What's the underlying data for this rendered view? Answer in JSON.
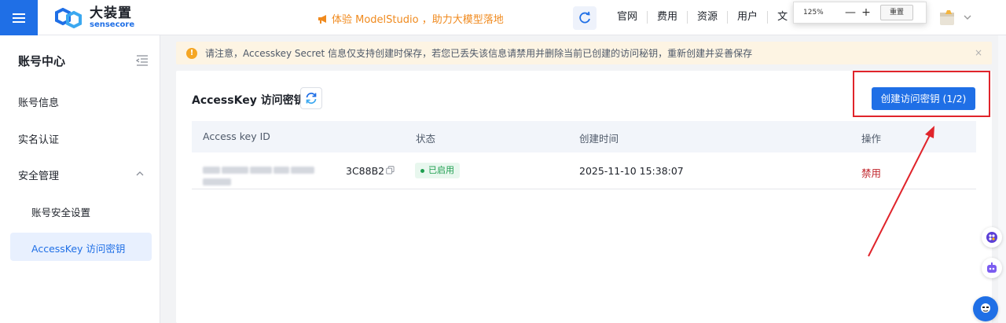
{
  "header": {
    "logo_cn": "大装置",
    "logo_en": "sensecore",
    "promo": "体验 ModelStudio ，助力大模型落地",
    "nav": [
      "官网",
      "费用",
      "资源",
      "用户",
      "文"
    ],
    "zoom": {
      "value": "125%",
      "minus": "—",
      "plus": "+",
      "reset": "重置"
    }
  },
  "sidebar": {
    "title": "账号中心",
    "items": [
      {
        "label": "账号信息"
      },
      {
        "label": "实名认证"
      },
      {
        "label": "安全管理"
      }
    ],
    "sub_items": [
      {
        "label": "账号安全设置"
      },
      {
        "label": "AccessKey 访问密钥"
      }
    ]
  },
  "notice": {
    "text": "请注意，Accesskey Secret 信息仅支持创建时保存，若您已丢失该信息请禁用并删除当前已创建的访问秘钥，重新创建并妥善保存",
    "close": "×"
  },
  "card": {
    "title": "AccessKey 访问密钥",
    "create_button": "创建访问密钥 (1/2)",
    "columns": [
      "Access key ID",
      "状态",
      "创建时间",
      "操作"
    ],
    "rows": [
      {
        "key_suffix": "3C88B2",
        "status": "已启用",
        "created": "2025-11-10 15:38:07",
        "action": "禁用"
      }
    ]
  },
  "colors": {
    "primary": "#1f6fe6",
    "warning": "#f08a1e",
    "danger": "#c0242b",
    "success": "#1e9e4f",
    "annotation_red": "#e0242b"
  }
}
